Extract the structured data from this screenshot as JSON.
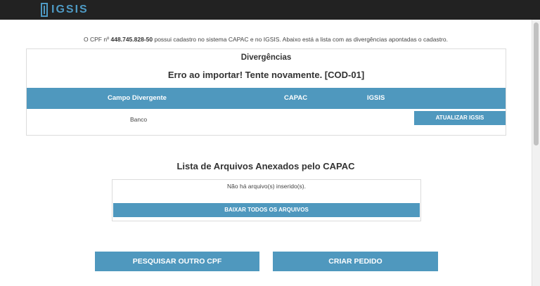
{
  "header": {
    "logo_text": "IGSIS"
  },
  "intro": {
    "prefix": "O CPF nº ",
    "cpf": "448.745.828-50",
    "suffix": " possui cadastro no sistema CAPAC e no IGSIS. Abaixo está a lista com as divergências apontadas o cadastro."
  },
  "divergencias": {
    "title": "Divergências",
    "error": "Erro ao importar! Tente novamente. [COD-01]",
    "columns": [
      "Campo Divergente",
      "CAPAC",
      "IGSIS"
    ],
    "rows": [
      {
        "campo": "Banco",
        "capac": "",
        "igsis": "",
        "action_label": "ATUALIZAR IGSIS"
      }
    ]
  },
  "arquivos": {
    "title": "Lista de Arquivos Anexados pelo CAPAC",
    "empty_text": "Não há arquivo(s) inserido(s).",
    "download_all_label": "BAIXAR TODOS OS ARQUIVOS"
  },
  "actions": {
    "search_other_label": "PESQUISAR OUTRO CPF",
    "create_order_label": "CRIAR PEDIDO"
  },
  "colors": {
    "accent": "#4f98be",
    "topbar": "#222222",
    "logo": "#4e9ac4"
  }
}
